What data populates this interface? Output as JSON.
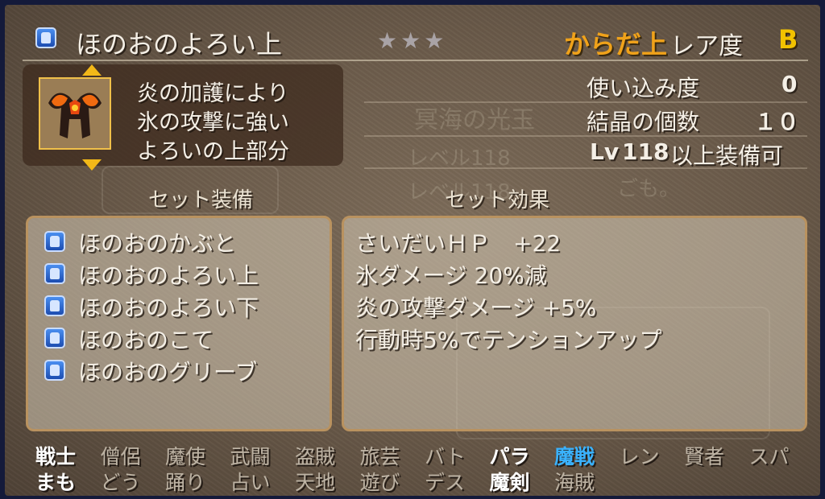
{
  "item": {
    "name": "ほのおのよろい上",
    "stars": "★★★",
    "body_part": "からだ上",
    "rarity_label": "レア度",
    "rarity_value": "B",
    "description": [
      "炎の加護により",
      "氷の攻撃に強い",
      "よろいの上部分"
    ]
  },
  "stats": {
    "usage_label": "使い込み度",
    "usage_value": "0",
    "crystal_label": "結晶の個数",
    "crystal_value": "１０",
    "lv_prefix": "Lv",
    "lv_value": "118",
    "lv_suffix": "以上装備可"
  },
  "set_equipment": {
    "header": "セット装備",
    "items": [
      {
        "name": "ほのおのかぶと",
        "icon": "helmet-icon"
      },
      {
        "name": "ほのおのよろい上",
        "icon": "armor-top-icon"
      },
      {
        "name": "ほのおのよろい下",
        "icon": "armor-bottom-icon"
      },
      {
        "name": "ほのおのこて",
        "icon": "gauntlet-icon"
      },
      {
        "name": "ほのおのグリーブ",
        "icon": "boots-icon"
      }
    ]
  },
  "set_effects": {
    "header": "セット効果",
    "items": [
      "さいだいＨＰ　+22",
      "氷ダメージ 20%減",
      "炎の攻撃ダメージ +5%",
      "行動時5%でテンションアップ"
    ]
  },
  "jobs": {
    "row1": [
      "戦士",
      "僧侶",
      "魔使",
      "武闘",
      "盗賊",
      "旅芸",
      "バト",
      "パラ",
      "魔戦",
      "レン",
      "賢者",
      "スパ"
    ],
    "row2": [
      "まも",
      "どう",
      "踊り",
      "占い",
      "天地",
      "遊び",
      "デス",
      "魔剣",
      "海賊"
    ],
    "active_color": "#3ab2ff"
  },
  "colors": {
    "accent_orange": "#f0a21a",
    "rarity_yellow": "#f2c200",
    "panel_border": "#b9925f"
  }
}
